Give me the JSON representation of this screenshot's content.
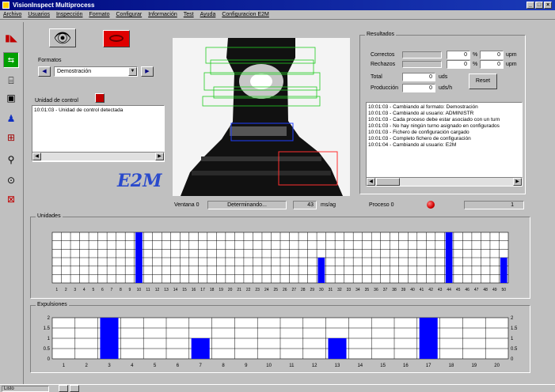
{
  "window": {
    "title": "VisionInspect Multiprocess"
  },
  "menu": [
    "Archivo",
    "Usuarios",
    "Inspección",
    "Formato",
    "Configurar",
    "Información",
    "Test",
    "Ayuda",
    "Configuracion E2M"
  ],
  "toolbar_icons": [
    "stop-icon",
    "run-icon",
    "camera-icon",
    "layout-icon",
    "users-icon",
    "config-icon",
    "search-icon",
    "link-icon",
    "trash-icon"
  ],
  "formatos": {
    "label": "Formatos",
    "selected": "Demostración"
  },
  "unidad_control": {
    "label": "Unidad de control",
    "log": [
      "10:01:03 - Unidad de control detectada"
    ]
  },
  "logo": "E2M",
  "resultados": {
    "label": "Resultados",
    "correctos_label": "Correctos",
    "correctos_pct": "0",
    "correctos_upm": "0",
    "rechazos_label": "Rechazos",
    "rechazos_pct": "0",
    "rechazos_upm": "0",
    "total_label": "Total",
    "total_value": "0",
    "unit_uds": "uds",
    "produccion_label": "Producción",
    "produccion_value": "0",
    "unit_udsh": "uds/h",
    "pct_sign": "%",
    "upm": "upm",
    "reset_label": "Reset"
  },
  "event_log": [
    "10:01:03 - Cambiando al formato: Demostración",
    "10:01:03 - Cambiando al usuario: ADMINISTR",
    "10:01:03 - Cada proceso debe estar asociado con un turn",
    "10:01:03 - No hay ningún turno asignado en configurados",
    "10:01:03 - Fichero de configuración cargado",
    "10:01:03 - Completo fichero de configuración",
    "10:01:04 - Cambiando al usuario: E2M"
  ],
  "status_row": {
    "ventana_label": "Ventana 0",
    "ventana_value": "Determinando...",
    "ventana_num": "43",
    "ventana_unit": "ms/ag",
    "proceso_label": "Proceso 0",
    "proceso_value": "1"
  },
  "sections": {
    "chart1_label": "Unidades",
    "chart2_label": "Expulsiones"
  },
  "status_bar": {
    "left": "Listo"
  },
  "chart_data": [
    {
      "type": "bar",
      "name": "Unidades",
      "categories": [
        "1",
        "2",
        "3",
        "4",
        "5",
        "6",
        "7",
        "8",
        "9",
        "10",
        "11",
        "12",
        "13",
        "14",
        "15",
        "16",
        "17",
        "18",
        "19",
        "20",
        "21",
        "22",
        "23",
        "24",
        "25",
        "26",
        "27",
        "28",
        "29",
        "30",
        "31",
        "32",
        "33",
        "34",
        "35",
        "36",
        "37",
        "38",
        "39",
        "40",
        "41",
        "42",
        "43",
        "44",
        "45",
        "46",
        "47",
        "48",
        "49",
        "50"
      ],
      "values": [
        0,
        0,
        0,
        0,
        0,
        0,
        0,
        0,
        0,
        4,
        0,
        0,
        0,
        0,
        0,
        0,
        0,
        0,
        0,
        0,
        0,
        0,
        0,
        0,
        0,
        0,
        0,
        0,
        0,
        2,
        0,
        0,
        0,
        0,
        0,
        0,
        0,
        0,
        0,
        0,
        0,
        0,
        0,
        4,
        0,
        0,
        0,
        0,
        0,
        2
      ],
      "ylim": [
        0,
        4
      ],
      "color": "#0000ff"
    },
    {
      "type": "bar",
      "name": "Expulsiones",
      "categories": [
        "1",
        "2",
        "3",
        "4",
        "5",
        "6",
        "7",
        "8",
        "9",
        "10",
        "11",
        "12",
        "13",
        "14",
        "15",
        "16",
        "17",
        "18",
        "19",
        "20"
      ],
      "values": [
        0,
        0,
        2,
        0,
        0,
        0,
        1,
        0,
        0,
        0,
        0,
        0,
        1,
        0,
        0,
        0,
        2,
        0,
        0,
        0
      ],
      "yticks": [
        "2",
        "1.5",
        "1",
        "0.5",
        "0"
      ],
      "ylim": [
        0,
        2
      ],
      "color": "#0000ff"
    }
  ]
}
